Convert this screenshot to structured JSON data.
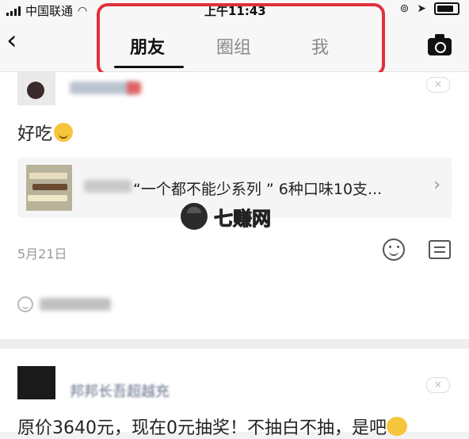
{
  "status_bar": {
    "carrier": "中国联通",
    "time": "上午11:43",
    "icons": [
      "signal-icon",
      "wifi-icon",
      "rotation-lock-icon",
      "location-icon",
      "battery-icon"
    ]
  },
  "navbar": {
    "back_icon": "chevron-left-icon",
    "tabs": [
      {
        "label": "朋友",
        "active": true
      },
      {
        "label": "圈组",
        "active": false
      },
      {
        "label": "我",
        "active": false
      }
    ],
    "camera_icon": "camera-icon",
    "highlight_color": "#e0303c"
  },
  "posts": [
    {
      "text": "好吃",
      "link": {
        "title": "“一个都不能少系列 ” 6种口味10支..."
      },
      "watermark": "七赚网",
      "date": "5月21日",
      "close_label": "×"
    },
    {
      "author": "邦邦长吾超越充",
      "text": "原价3640元，现在0元抽奖！不抽白不抽，是吧",
      "close_label": "×"
    }
  ]
}
